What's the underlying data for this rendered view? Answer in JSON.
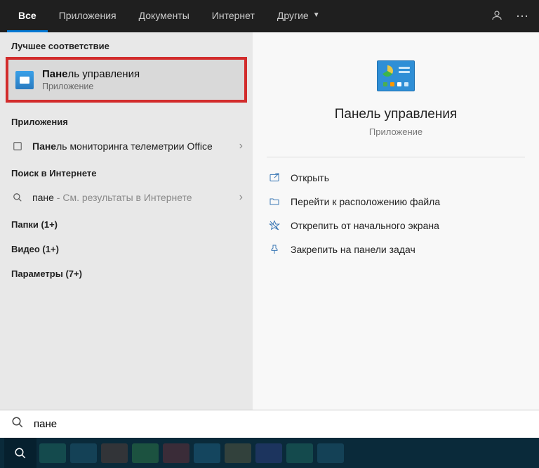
{
  "tabs": {
    "all": "Все",
    "apps": "Приложения",
    "documents": "Документы",
    "internet": "Интернет",
    "other": "Другие"
  },
  "sections": {
    "best_match": "Лучшее соответствие",
    "apps": "Приложения",
    "web": "Поиск в Интернете",
    "folders": "Папки (1+)",
    "video": "Видео (1+)",
    "settings": "Параметры (7+)"
  },
  "best_match_item": {
    "title_bold": "Пане",
    "title_rest": "ль управления",
    "subtitle": "Приложение"
  },
  "app_result": {
    "bold": "Пане",
    "rest": "ль мониторинга телеметрии Office"
  },
  "web_result": {
    "bold": "пане",
    "hint": " - См. результаты в Интернете"
  },
  "detail": {
    "title": "Панель управления",
    "subtitle": "Приложение"
  },
  "actions": {
    "open": "Открыть",
    "open_location": "Перейти к расположению файла",
    "unpin_start": "Открепить от начального экрана",
    "pin_taskbar": "Закрепить на панели задач"
  },
  "search": {
    "value": "пане"
  }
}
